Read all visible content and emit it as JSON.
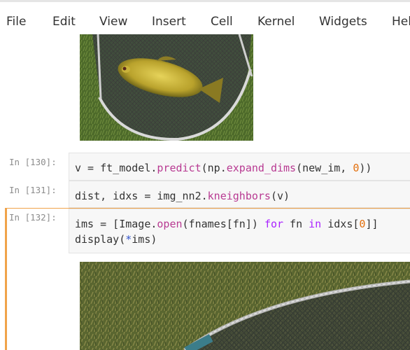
{
  "menubar": {
    "items": [
      "File",
      "Edit",
      "View",
      "Insert",
      "Cell",
      "Kernel",
      "Widgets",
      "Help"
    ]
  },
  "cells": [
    {
      "prompt": "In [130]:",
      "code_line": "v = ft_model.predict(np.expand_dims(new_im, 0))"
    },
    {
      "prompt": "In [131]:",
      "code_line": "dist, idxs = img_nn2.kneighbors(v)"
    },
    {
      "prompt": "In [132]:",
      "code_lines": [
        "ims = [Image.open(fnames[fn]) for fn in idxs[0]]",
        "display(*ims)"
      ]
    }
  ],
  "colors": {
    "selected_cell_border": "#f0a34a",
    "input_background": "#f7f7f7",
    "keyword": "#aa22ff",
    "function": "#b83a92",
    "number": "#e36f0c"
  }
}
